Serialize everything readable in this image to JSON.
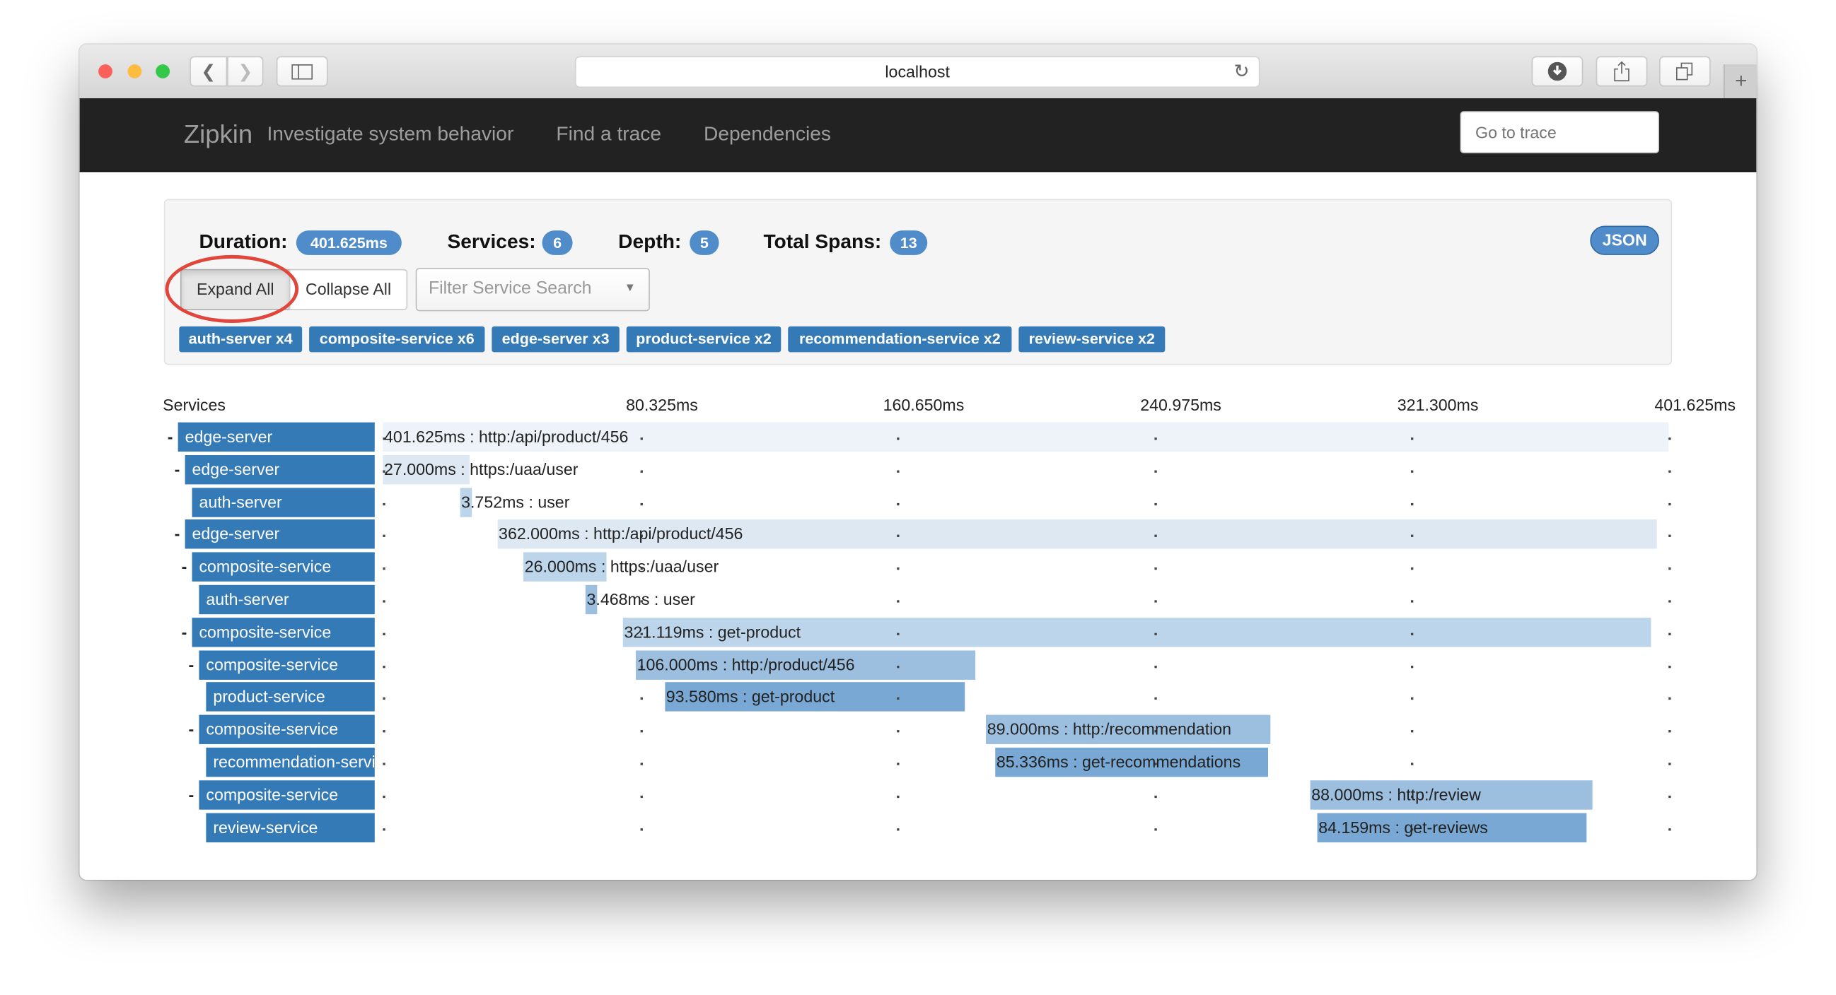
{
  "browser": {
    "url": "localhost",
    "icons": [
      "back-icon",
      "forward-icon",
      "sidebar-icon",
      "reload-icon",
      "download-icon",
      "share-icon",
      "tabs-icon",
      "new-tab-icon"
    ]
  },
  "navbar": {
    "brand": "Zipkin",
    "tagline": "Investigate system behavior",
    "links": [
      "Find a trace",
      "Dependencies"
    ],
    "goto_placeholder": "Go to trace"
  },
  "summary": {
    "duration_label": "Duration:",
    "duration": "401.625ms",
    "services_label": "Services:",
    "services": "6",
    "depth_label": "Depth:",
    "depth": "5",
    "total_spans_label": "Total Spans:",
    "total_spans": "13",
    "json_label": "JSON",
    "expand_all": "Expand All",
    "collapse_all": "Collapse All",
    "filter_placeholder": "Filter Service Search",
    "highlight_color": "#e0463b",
    "service_tags": [
      "auth-server x4",
      "composite-service x6",
      "edge-server x3",
      "product-service x2",
      "recommendation-service x2",
      "review-service x2"
    ]
  },
  "timeline": {
    "services_header": "Services",
    "total_ms": 401.625,
    "ticks": [
      "80.325ms",
      "160.650ms",
      "240.975ms",
      "321.300ms",
      "401.625ms"
    ],
    "accent": "#337ab7",
    "spans": [
      {
        "service": "edge-server",
        "depth": 0,
        "collapsible": true,
        "start_ms": 0,
        "duration_ms": 401.625,
        "label": "401.625ms : http:/api/product/456"
      },
      {
        "service": "edge-server",
        "depth": 1,
        "collapsible": true,
        "start_ms": 0,
        "duration_ms": 27.0,
        "label": "27.000ms : https:/uaa/user"
      },
      {
        "service": "auth-server",
        "depth": 2,
        "collapsible": false,
        "start_ms": 24.1,
        "duration_ms": 3.752,
        "label": "3.752ms : user"
      },
      {
        "service": "edge-server",
        "depth": 1,
        "collapsible": true,
        "start_ms": 35.8,
        "duration_ms": 362.0,
        "label": "362.000ms : http:/api/product/456"
      },
      {
        "service": "composite-service",
        "depth": 2,
        "collapsible": true,
        "start_ms": 43.9,
        "duration_ms": 26.0,
        "label": "26.000ms : https:/uaa/user"
      },
      {
        "service": "auth-server",
        "depth": 3,
        "collapsible": false,
        "start_ms": 63.3,
        "duration_ms": 3.468,
        "label": "3.468ms : user"
      },
      {
        "service": "composite-service",
        "depth": 2,
        "collapsible": true,
        "start_ms": 75.0,
        "duration_ms": 321.119,
        "label": "321.119ms : get-product"
      },
      {
        "service": "composite-service",
        "depth": 3,
        "collapsible": true,
        "start_ms": 79.0,
        "duration_ms": 106.0,
        "label": "106.000ms : http:/product/456"
      },
      {
        "service": "product-service",
        "depth": 4,
        "collapsible": false,
        "start_ms": 88.1,
        "duration_ms": 93.58,
        "label": "93.580ms : get-product"
      },
      {
        "service": "composite-service",
        "depth": 3,
        "collapsible": true,
        "start_ms": 188.4,
        "duration_ms": 89.0,
        "label": "89.000ms : http:/recommendation"
      },
      {
        "service": "recommendation-service",
        "depth": 4,
        "collapsible": false,
        "start_ms": 191.3,
        "duration_ms": 85.336,
        "label": "85.336ms : get-recommendations"
      },
      {
        "service": "composite-service",
        "depth": 3,
        "collapsible": true,
        "start_ms": 289.7,
        "duration_ms": 88.0,
        "label": "88.000ms : http:/review"
      },
      {
        "service": "review-service",
        "depth": 4,
        "collapsible": false,
        "start_ms": 291.9,
        "duration_ms": 84.159,
        "label": "84.159ms : get-reviews"
      }
    ],
    "depth_colors": [
      "#eef3fa",
      "#dde8f3",
      "#bdd5ea",
      "#9dbfdf",
      "#78a8d3"
    ]
  }
}
